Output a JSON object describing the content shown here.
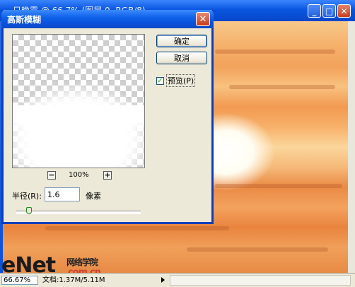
{
  "document_window": {
    "title": "一日晚霞 @ 66.7% (图层 0, RGB/8)",
    "minimize_symbol": "_",
    "maximize_symbol": "□",
    "close_symbol": "✕"
  },
  "status_bar": {
    "zoom": "66.67%",
    "doc_info": "文档:1.37M/5.11M"
  },
  "watermark": {
    "brand": "eNet",
    "subtitle": "网络学院",
    "domain": ".com.cn"
  },
  "dialog": {
    "title": "高斯模糊",
    "close_symbol": "✕",
    "ok_label": "确定",
    "cancel_label": "取消",
    "preview_label": "预览(P)",
    "preview_checked": true,
    "zoom_minus": "−",
    "zoom_plus": "+",
    "zoom_value": "100%",
    "radius_label": "半径(R):",
    "radius_value": "1.6",
    "radius_unit": "像素",
    "radius_slider_fraction": 0.1
  }
}
